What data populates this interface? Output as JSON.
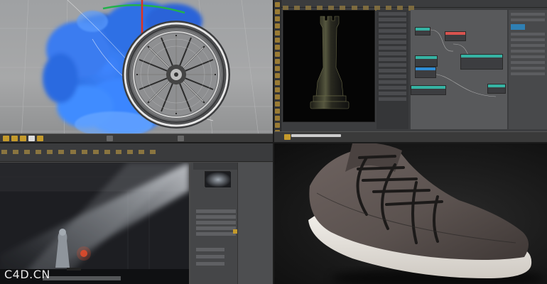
{
  "watermark": {
    "text": "C4D.CN"
  },
  "panels": {
    "top_left": {
      "subject": "wheel-with-smoke-simulation",
      "colors": {
        "smoke": "#2b6fd9",
        "rim": "#d7d7d7",
        "axis_y": "#e0331f",
        "axis_x": "#22b14c"
      }
    },
    "top_right": {
      "subject": "node-editor-with-chess-rook"
    },
    "bottom_left": {
      "subject": "volumetric-light-render"
    },
    "bottom_right": {
      "subject": "sneaker-render",
      "colors": {
        "fabric": "#5f5552",
        "sole": "#e8e4df"
      }
    }
  }
}
